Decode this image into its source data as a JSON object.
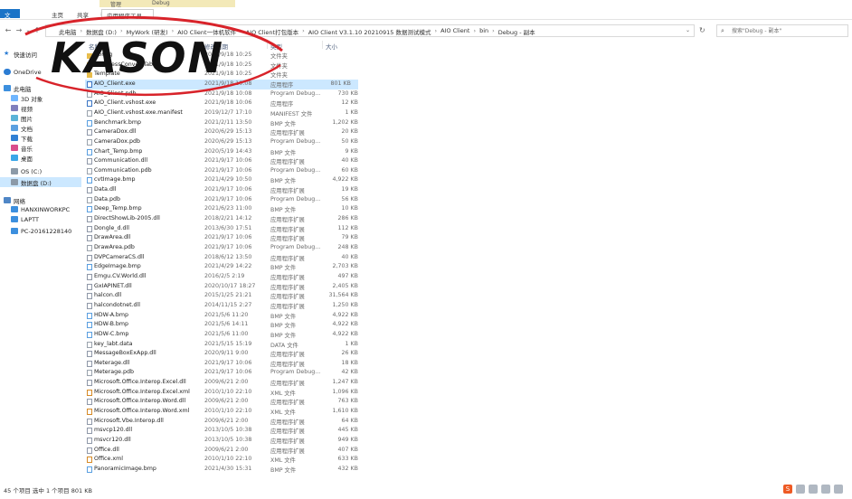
{
  "ribbon": {
    "context_tab": "管理",
    "context_title": "Debug",
    "tabs": [
      {
        "label": "文件"
      },
      {
        "label": "主页"
      },
      {
        "label": "共享"
      },
      {
        "label": "查看"
      },
      {
        "label": "应用程序工具"
      }
    ]
  },
  "address": {
    "crumbs": [
      "此电脑",
      "数据盘 (D:)",
      "MyWork (研发)",
      "AIO Client一体机软件",
      "AIO Client打包版本",
      "AIO Client V3.1.10 20210915 数据测试模式",
      "AIO Client",
      "bin",
      "Debug - 副本"
    ]
  },
  "search": {
    "placeholder": "搜索\"Debug - 副本\""
  },
  "nav": [
    {
      "label": "快速访问",
      "icon": "quick-access-star-icon",
      "selected": false
    },
    {
      "label": "OneDrive",
      "icon": "onedrive-cloud-icon",
      "selected": false
    },
    {
      "label": "此电脑",
      "icon": "this-pc-icon",
      "selected": false
    },
    {
      "label": "3D 对象",
      "icon": "3d-objects-icon",
      "selected": false
    },
    {
      "label": "视频",
      "icon": "videos-icon",
      "selected": false
    },
    {
      "label": "图片",
      "icon": "pictures-icon",
      "selected": false
    },
    {
      "label": "文档",
      "icon": "documents-icon",
      "selected": false
    },
    {
      "label": "下载",
      "icon": "downloads-icon",
      "selected": false
    },
    {
      "label": "音乐",
      "icon": "music-icon",
      "selected": false
    },
    {
      "label": "桌面",
      "icon": "desktop-icon",
      "selected": false
    },
    {
      "label": "OS (C:)",
      "icon": "drive-icon",
      "selected": false
    },
    {
      "label": "数据盘 (D:)",
      "icon": "drive-icon",
      "selected": true
    },
    {
      "label": "网络",
      "icon": "network-icon",
      "selected": false
    },
    {
      "label": "HANXINWORKPC",
      "icon": "computer-icon",
      "selected": false
    },
    {
      "label": "LAPTT",
      "icon": "computer-icon",
      "selected": false
    },
    {
      "label": "PC-20161228140",
      "icon": "computer-icon",
      "selected": false
    }
  ],
  "columns": {
    "name": "名称",
    "date": "修改日期",
    "type": "类型",
    "size": "大小"
  },
  "files": [
    {
      "name": "Config",
      "date": "2021/9/18 10:25",
      "type": "文件夹",
      "size": "",
      "kind": "folder"
    },
    {
      "name": "HardnessConvertTable",
      "date": "2021/9/18 10:25",
      "type": "文件夹",
      "size": "",
      "kind": "folder"
    },
    {
      "name": "Template",
      "date": "2021/9/18 10:25",
      "type": "文件夹",
      "size": "",
      "kind": "folder"
    },
    {
      "name": "AIO_Client.exe",
      "date": "2021/9/18 10:08",
      "type": "应用程序",
      "size": "801 KB",
      "kind": "exe"
    },
    {
      "name": "AIO_Client.pdb",
      "date": "2021/9/18 10:08",
      "type": "Program Debug...",
      "size": "730 KB",
      "kind": "doc"
    },
    {
      "name": "AIO_Client.vshost.exe",
      "date": "2021/9/18 10:06",
      "type": "应用程序",
      "size": "12 KB",
      "kind": "exe"
    },
    {
      "name": "AIO_Client.vshost.exe.manifest",
      "date": "2019/12/7 17:10",
      "type": "MANIFEST 文件",
      "size": "1 KB",
      "kind": "doc"
    },
    {
      "name": "Benchmark.bmp",
      "date": "2021/2/11 13:50",
      "type": "BMP 文件",
      "size": "1,202 KB",
      "kind": "bmp"
    },
    {
      "name": "CameraDox.dll",
      "date": "2020/6/29 15:13",
      "type": "应用程序扩展",
      "size": "20 KB",
      "kind": "dll"
    },
    {
      "name": "CameraDox.pdb",
      "date": "2020/6/29 15:13",
      "type": "Program Debug...",
      "size": "50 KB",
      "kind": "doc"
    },
    {
      "name": "Chart_Temp.bmp",
      "date": "2020/5/19 14:43",
      "type": "BMP 文件",
      "size": "9 KB",
      "kind": "bmp"
    },
    {
      "name": "Communication.dll",
      "date": "2021/9/17 10:06",
      "type": "应用程序扩展",
      "size": "40 KB",
      "kind": "dll"
    },
    {
      "name": "Communication.pdb",
      "date": "2021/9/17 10:06",
      "type": "Program Debug...",
      "size": "60 KB",
      "kind": "doc"
    },
    {
      "name": "cvtImage.bmp",
      "date": "2021/4/29 10:50",
      "type": "BMP 文件",
      "size": "4,922 KB",
      "kind": "bmp"
    },
    {
      "name": "Data.dll",
      "date": "2021/9/17 10:06",
      "type": "应用程序扩展",
      "size": "19 KB",
      "kind": "dll"
    },
    {
      "name": "Data.pdb",
      "date": "2021/9/17 10:06",
      "type": "Program Debug...",
      "size": "56 KB",
      "kind": "doc"
    },
    {
      "name": "Deep_Temp.bmp",
      "date": "2021/6/23 11:00",
      "type": "BMP 文件",
      "size": "10 KB",
      "kind": "bmp"
    },
    {
      "name": "DirectShowLib-2005.dll",
      "date": "2018/2/21 14:12",
      "type": "应用程序扩展",
      "size": "286 KB",
      "kind": "dll"
    },
    {
      "name": "Dongle_d.dll",
      "date": "2013/6/30 17:51",
      "type": "应用程序扩展",
      "size": "112 KB",
      "kind": "dll"
    },
    {
      "name": "DrawArea.dll",
      "date": "2021/9/17 10:06",
      "type": "应用程序扩展",
      "size": "79 KB",
      "kind": "dll"
    },
    {
      "name": "DrawArea.pdb",
      "date": "2021/9/17 10:06",
      "type": "Program Debug...",
      "size": "248 KB",
      "kind": "doc"
    },
    {
      "name": "DVPCameraCS.dll",
      "date": "2018/6/12 13:50",
      "type": "应用程序扩展",
      "size": "40 KB",
      "kind": "dll"
    },
    {
      "name": "EdgeImage.bmp",
      "date": "2021/4/29 14:22",
      "type": "BMP 文件",
      "size": "2,703 KB",
      "kind": "bmp"
    },
    {
      "name": "Emgu.CV.World.dll",
      "date": "2016/2/5 2:19",
      "type": "应用程序扩展",
      "size": "497 KB",
      "kind": "dll"
    },
    {
      "name": "GxIAPINET.dll",
      "date": "2020/10/17 18:27",
      "type": "应用程序扩展",
      "size": "2,405 KB",
      "kind": "dll"
    },
    {
      "name": "halcon.dll",
      "date": "2015/1/25 21:21",
      "type": "应用程序扩展",
      "size": "31,564 KB",
      "kind": "dll"
    },
    {
      "name": "halcondotnet.dll",
      "date": "2014/11/15 2:27",
      "type": "应用程序扩展",
      "size": "1,250 KB",
      "kind": "dll"
    },
    {
      "name": "HDW-A.bmp",
      "date": "2021/5/6 11:20",
      "type": "BMP 文件",
      "size": "4,922 KB",
      "kind": "bmp"
    },
    {
      "name": "HDW-B.bmp",
      "date": "2021/5/6 14:11",
      "type": "BMP 文件",
      "size": "4,922 KB",
      "kind": "bmp"
    },
    {
      "name": "HDW-C.bmp",
      "date": "2021/5/6 11:00",
      "type": "BMP 文件",
      "size": "4,922 KB",
      "kind": "bmp"
    },
    {
      "name": "key_labt.data",
      "date": "2021/5/15 15:19",
      "type": "DATA 文件",
      "size": "1 KB",
      "kind": "doc"
    },
    {
      "name": "MessageBoxExApp.dll",
      "date": "2020/9/11 9:00",
      "type": "应用程序扩展",
      "size": "26 KB",
      "kind": "dll"
    },
    {
      "name": "Meterage.dll",
      "date": "2021/9/17 10:06",
      "type": "应用程序扩展",
      "size": "18 KB",
      "kind": "dll"
    },
    {
      "name": "Meterage.pdb",
      "date": "2021/9/17 10:06",
      "type": "Program Debug...",
      "size": "42 KB",
      "kind": "doc"
    },
    {
      "name": "Microsoft.Office.Interop.Excel.dll",
      "date": "2009/6/21 2:00",
      "type": "应用程序扩展",
      "size": "1,247 KB",
      "kind": "dll"
    },
    {
      "name": "Microsoft.Office.Interop.Excel.xml",
      "date": "2010/1/10 22:10",
      "type": "XML 文件",
      "size": "1,096 KB",
      "kind": "xml"
    },
    {
      "name": "Microsoft.Office.Interop.Word.dll",
      "date": "2009/6/21 2:00",
      "type": "应用程序扩展",
      "size": "763 KB",
      "kind": "dll"
    },
    {
      "name": "Microsoft.Office.Interop.Word.xml",
      "date": "2010/1/10 22:10",
      "type": "XML 文件",
      "size": "1,610 KB",
      "kind": "xml"
    },
    {
      "name": "Microsoft.Vbe.Interop.dll",
      "date": "2009/6/21 2:00",
      "type": "应用程序扩展",
      "size": "64 KB",
      "kind": "dll"
    },
    {
      "name": "msvcp120.dll",
      "date": "2013/10/5 10:38",
      "type": "应用程序扩展",
      "size": "445 KB",
      "kind": "dll"
    },
    {
      "name": "msvcr120.dll",
      "date": "2013/10/5 10:38",
      "type": "应用程序扩展",
      "size": "949 KB",
      "kind": "dll"
    },
    {
      "name": "Office.dll",
      "date": "2009/6/21 2:00",
      "type": "应用程序扩展",
      "size": "407 KB",
      "kind": "dll"
    },
    {
      "name": "Office.xml",
      "date": "2010/1/10 22:10",
      "type": "XML 文件",
      "size": "633 KB",
      "kind": "xml"
    },
    {
      "name": "PanoramicImage.bmp",
      "date": "2021/4/30 15:31",
      "type": "BMP 文件",
      "size": "432 KB",
      "kind": "bmp"
    }
  ],
  "selected_index": 3,
  "status": {
    "text": "45 个项目   选中 1 个项目  801 KB"
  },
  "watermark": {
    "text": "KASON",
    "color": "#d8232a"
  }
}
